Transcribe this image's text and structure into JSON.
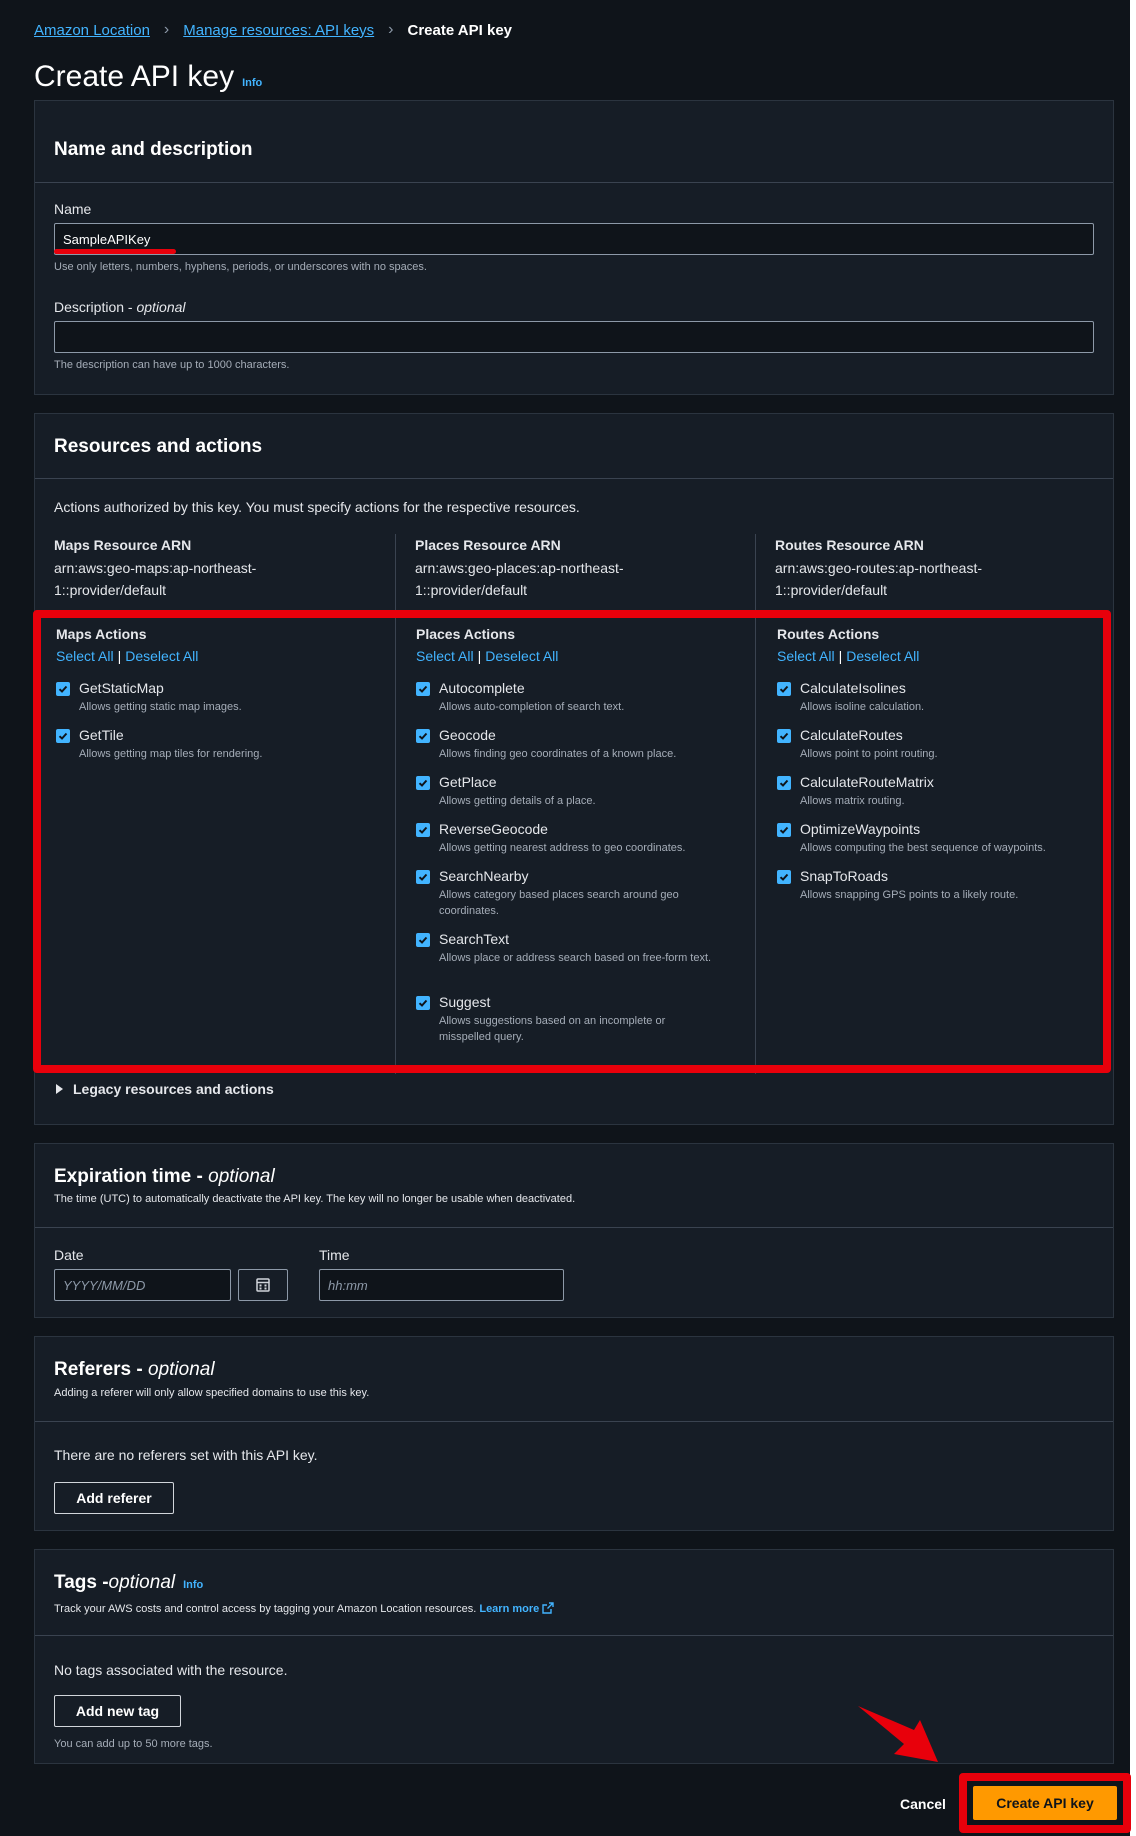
{
  "breadcrumb": {
    "items": [
      "Amazon Location",
      "Manage resources: API keys"
    ],
    "current": "Create API key"
  },
  "page": {
    "title": "Create API key",
    "info": "Info"
  },
  "name_section": {
    "title": "Name and description",
    "name_label": "Name",
    "name_value": "SampleAPIKey",
    "name_hint": "Use only letters, numbers, hyphens, periods, or underscores with no spaces.",
    "desc_label": "Description - ",
    "desc_optional": "optional",
    "desc_value": "",
    "desc_hint": "The description can have up to 1000 characters."
  },
  "resources": {
    "title": "Resources and actions",
    "intro": "Actions authorized by this key. You must specify actions for the respective resources.",
    "select_all": "Select All",
    "separator": "|",
    "deselect_all": "Deselect All",
    "legacy": "Legacy resources and actions",
    "columns": [
      {
        "arn_title": "Maps Resource ARN",
        "arn_value": "arn:aws:geo-maps:ap-northeast-1::provider/default",
        "actions_title": "Maps Actions",
        "actions": [
          {
            "name": "GetStaticMap",
            "desc": "Allows getting static map images.",
            "checked": true
          },
          {
            "name": "GetTile",
            "desc": "Allows getting map tiles for rendering.",
            "checked": true
          }
        ]
      },
      {
        "arn_title": "Places Resource ARN",
        "arn_value": "arn:aws:geo-places:ap-northeast-1::provider/default",
        "actions_title": "Places Actions",
        "actions": [
          {
            "name": "Autocomplete",
            "desc": "Allows auto-completion of search text.",
            "checked": true
          },
          {
            "name": "Geocode",
            "desc": "Allows finding geo coordinates of a known place.",
            "checked": true
          },
          {
            "name": "GetPlace",
            "desc": "Allows getting details of a place.",
            "checked": true
          },
          {
            "name": "ReverseGeocode",
            "desc": "Allows getting nearest address to geo coordinates.",
            "checked": true
          },
          {
            "name": "SearchNearby",
            "desc": "Allows category based places search around geo coordinates.",
            "checked": true
          },
          {
            "name": "SearchText",
            "desc": "Allows place or address search based on free-form text.",
            "checked": true
          },
          {
            "name": "Suggest",
            "desc": "Allows suggestions based on an incomplete or misspelled query.",
            "checked": true
          }
        ]
      },
      {
        "arn_title": "Routes Resource ARN",
        "arn_value": "arn:aws:geo-routes:ap-northeast-1::provider/default",
        "actions_title": "Routes Actions",
        "actions": [
          {
            "name": "CalculateIsolines",
            "desc": "Allows isoline calculation.",
            "checked": true
          },
          {
            "name": "CalculateRoutes",
            "desc": "Allows point to point routing.",
            "checked": true
          },
          {
            "name": "CalculateRouteMatrix",
            "desc": "Allows matrix routing.",
            "checked": true
          },
          {
            "name": "OptimizeWaypoints",
            "desc": "Allows computing the best sequence of waypoints.",
            "checked": true
          },
          {
            "name": "SnapToRoads",
            "desc": "Allows snapping GPS points to a likely route.",
            "checked": true
          }
        ]
      }
    ]
  },
  "expiration": {
    "title": "Expiration time - ",
    "optional": "optional",
    "sub": "The time (UTC) to automatically deactivate the API key. The key will no longer be usable when deactivated.",
    "date_label": "Date",
    "date_placeholder": "YYYY/MM/DD",
    "time_label": "Time",
    "time_placeholder": "hh:mm",
    "calendar_icon": "calendar-icon"
  },
  "referers": {
    "title": "Referers - ",
    "optional": "optional",
    "sub": "Adding a referer will only allow specified domains to use this key.",
    "empty": "There are no referers set with this API key.",
    "add_button": "Add referer"
  },
  "tags": {
    "title": "Tags - ",
    "optional": "optional",
    "info": "Info",
    "sub": "Track your AWS costs and control access by tagging your Amazon Location resources.",
    "learn_more": "Learn more",
    "empty": "No tags associated with the resource.",
    "add_button": "Add new tag",
    "hint": "You can add up to 50 more tags."
  },
  "footer": {
    "cancel": "Cancel",
    "create": "Create API key"
  },
  "colors": {
    "accent": "#42b4ff",
    "primary": "#ff9900",
    "highlight": "#e8000b"
  }
}
